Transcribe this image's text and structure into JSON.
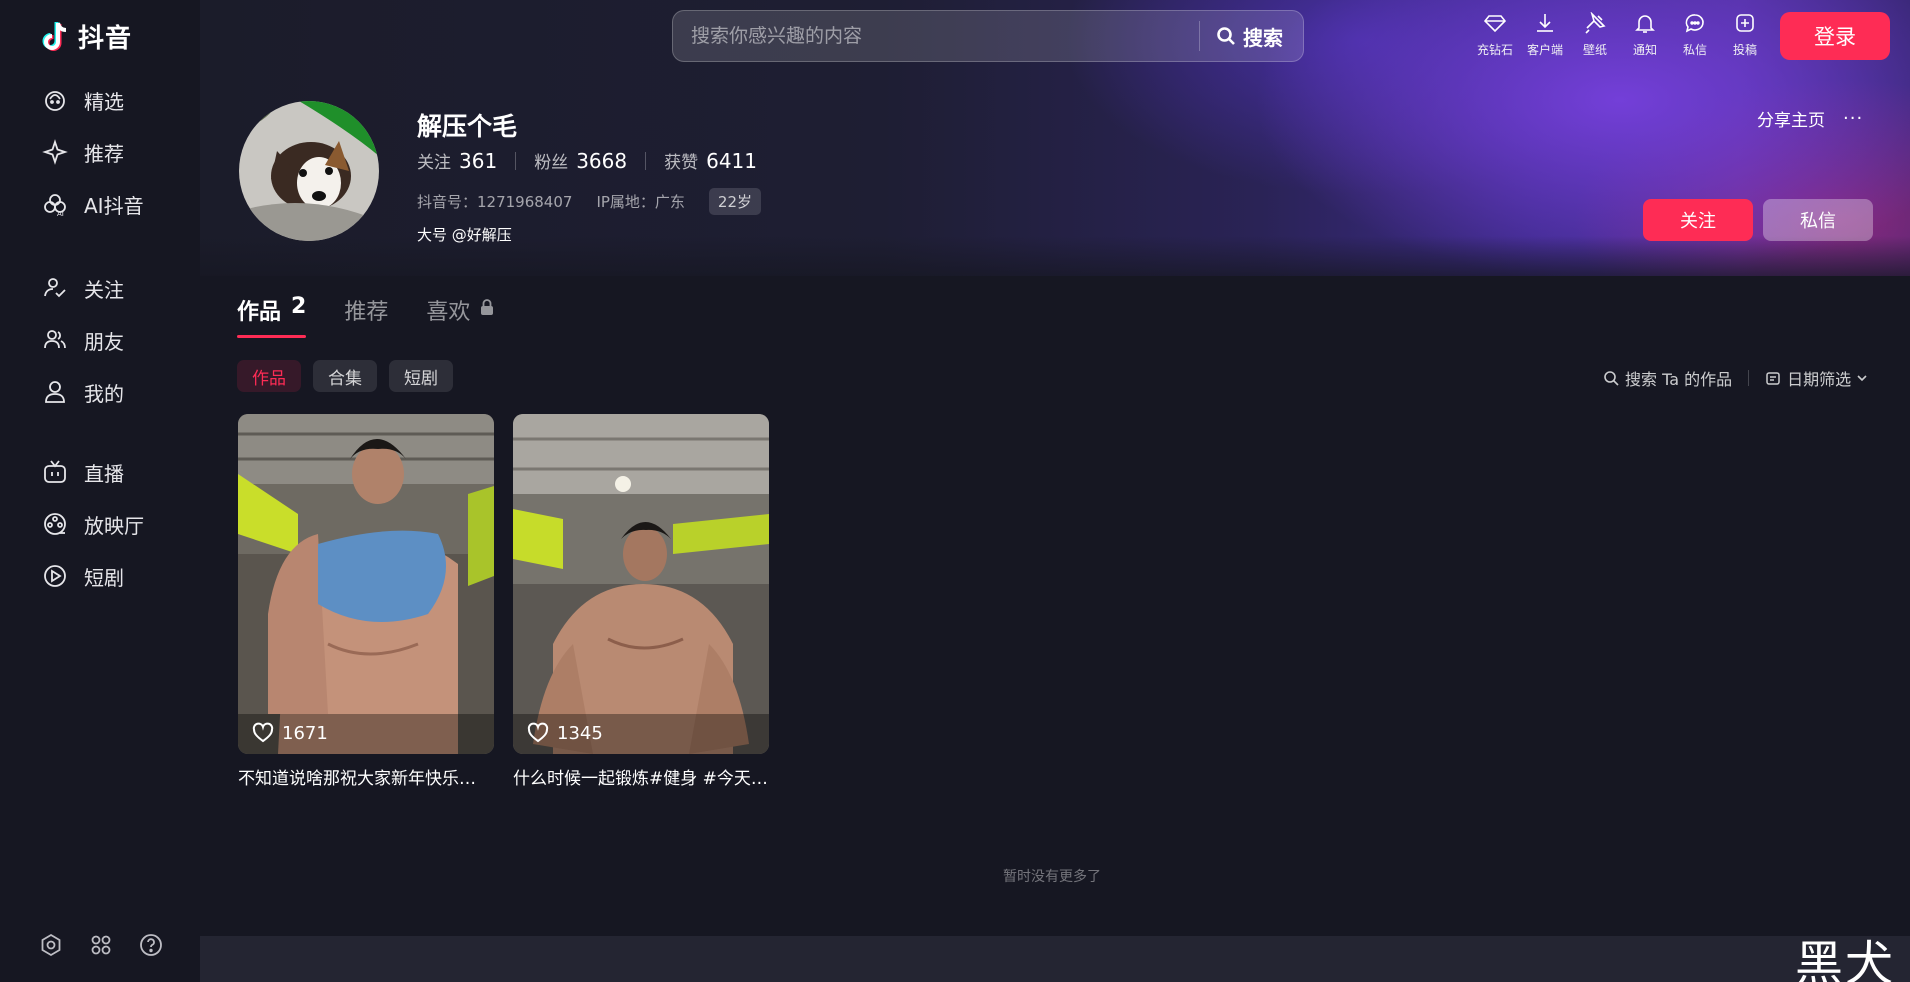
{
  "app": {
    "name": "抖音"
  },
  "sidebar": {
    "items": [
      {
        "label": "精选"
      },
      {
        "label": "推荐"
      },
      {
        "label": "AI抖音"
      },
      {
        "label": "关注"
      },
      {
        "label": "朋友"
      },
      {
        "label": "我的"
      },
      {
        "label": "直播"
      },
      {
        "label": "放映厅"
      },
      {
        "label": "短剧"
      }
    ]
  },
  "header": {
    "search_placeholder": "搜索你感兴趣的内容",
    "search_button": "搜索",
    "actions": [
      {
        "label": "充钻石",
        "icon": "diamond-icon"
      },
      {
        "label": "客户端",
        "icon": "download-icon"
      },
      {
        "label": "壁纸",
        "icon": "pin-icon"
      },
      {
        "label": "通知",
        "icon": "bell-icon"
      },
      {
        "label": "私信",
        "icon": "message-icon"
      },
      {
        "label": "投稿",
        "icon": "upload-icon"
      }
    ],
    "login_button": "登录"
  },
  "profile": {
    "name": "解压个毛",
    "stats": [
      {
        "label": "关注",
        "value": "361"
      },
      {
        "label": "粉丝",
        "value": "3668"
      },
      {
        "label": "获赞",
        "value": "6411"
      }
    ],
    "douyin_id": "抖音号：1271968407",
    "ip_location": "IP属地：广东",
    "age": "22岁",
    "bio": "大号 @好解压",
    "share_label": "分享主页",
    "more_label": "···",
    "follow_button": "关注",
    "message_button": "私信"
  },
  "tabs": [
    {
      "label": "作品",
      "count": "2",
      "active": true
    },
    {
      "label": "推荐"
    },
    {
      "label": "喜欢",
      "locked": true
    }
  ],
  "filters": {
    "chips": [
      {
        "label": "作品",
        "active": true
      },
      {
        "label": "合集"
      },
      {
        "label": "短剧"
      }
    ],
    "search_label": "搜索 Ta 的作品",
    "date_filter_label": "日期筛选"
  },
  "videos": [
    {
      "likes": "1671",
      "title": "不知道说啥那祝大家新年快乐…"
    },
    {
      "likes": "1345",
      "title": "什么时候一起锻炼#健身 #今天…"
    }
  ],
  "footer": {
    "no_more": "暂时没有更多了"
  },
  "watermark": "黑犬",
  "colors": {
    "accent": "#fe2c55",
    "background": "#161722"
  }
}
